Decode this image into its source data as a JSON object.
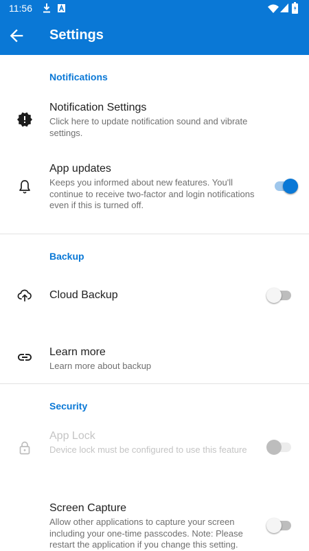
{
  "status_bar": {
    "time": "11:56",
    "icons": [
      "download-icon",
      "app-notification-icon",
      "wifi-icon",
      "signal-icon",
      "battery-icon"
    ]
  },
  "app_bar": {
    "title": "Settings",
    "back_icon": "arrow-back-icon"
  },
  "colors": {
    "primary": "#0a78d6",
    "toggle_on_track": "#9fc7ec",
    "divider": "#e2e2e2",
    "secondary_text": "#6f6f6f",
    "disabled_text": "#c4c4c4"
  },
  "sections": {
    "notifications": {
      "header": "Notifications",
      "items": [
        {
          "icon": "alert-badge-icon",
          "title": "Notification Settings",
          "subtitle": "Click here to update notification sound and vibrate settings."
        },
        {
          "icon": "bell-icon",
          "title": "App updates",
          "subtitle": "Keeps you informed about new features. You'll continue to receive two-factor and login notifications even if this is turned off.",
          "toggle": true
        }
      ]
    },
    "backup": {
      "header": "Backup",
      "items": [
        {
          "icon": "cloud-upload-icon",
          "title": "Cloud Backup",
          "toggle": false
        },
        {
          "icon": "link-icon",
          "title": "Learn more",
          "subtitle": "Learn more about backup"
        }
      ]
    },
    "security": {
      "header": "Security",
      "items": [
        {
          "icon": "lock-icon",
          "title": "App Lock",
          "subtitle": "Device lock must be configured to use this feature",
          "toggle": false,
          "disabled": true
        },
        {
          "title": "Screen Capture",
          "subtitle": "Allow other applications to capture your screen including your one-time passcodes. Note: Please restart the application if you change this setting.",
          "toggle": false
        }
      ]
    }
  }
}
